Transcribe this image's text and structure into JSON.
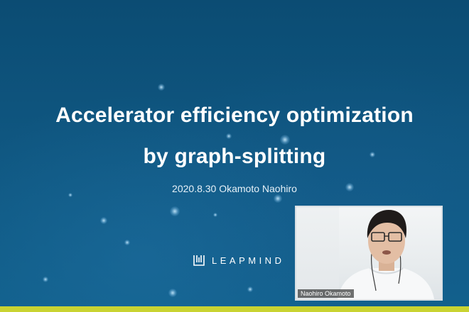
{
  "slide": {
    "title_line1": "Accelerator efficiency optimization",
    "title_line2": "by graph-splitting",
    "subtitle": "2020.8.30 Okamoto Naohiro",
    "logo_text": "LEAPMIND"
  },
  "video": {
    "participant_name": "Naohiro Okamoto"
  },
  "colors": {
    "background": "#0f5680",
    "accent_bar": "#c9d331",
    "text": "#ffffff"
  },
  "icons": [
    "leapmind-logo-icon"
  ]
}
